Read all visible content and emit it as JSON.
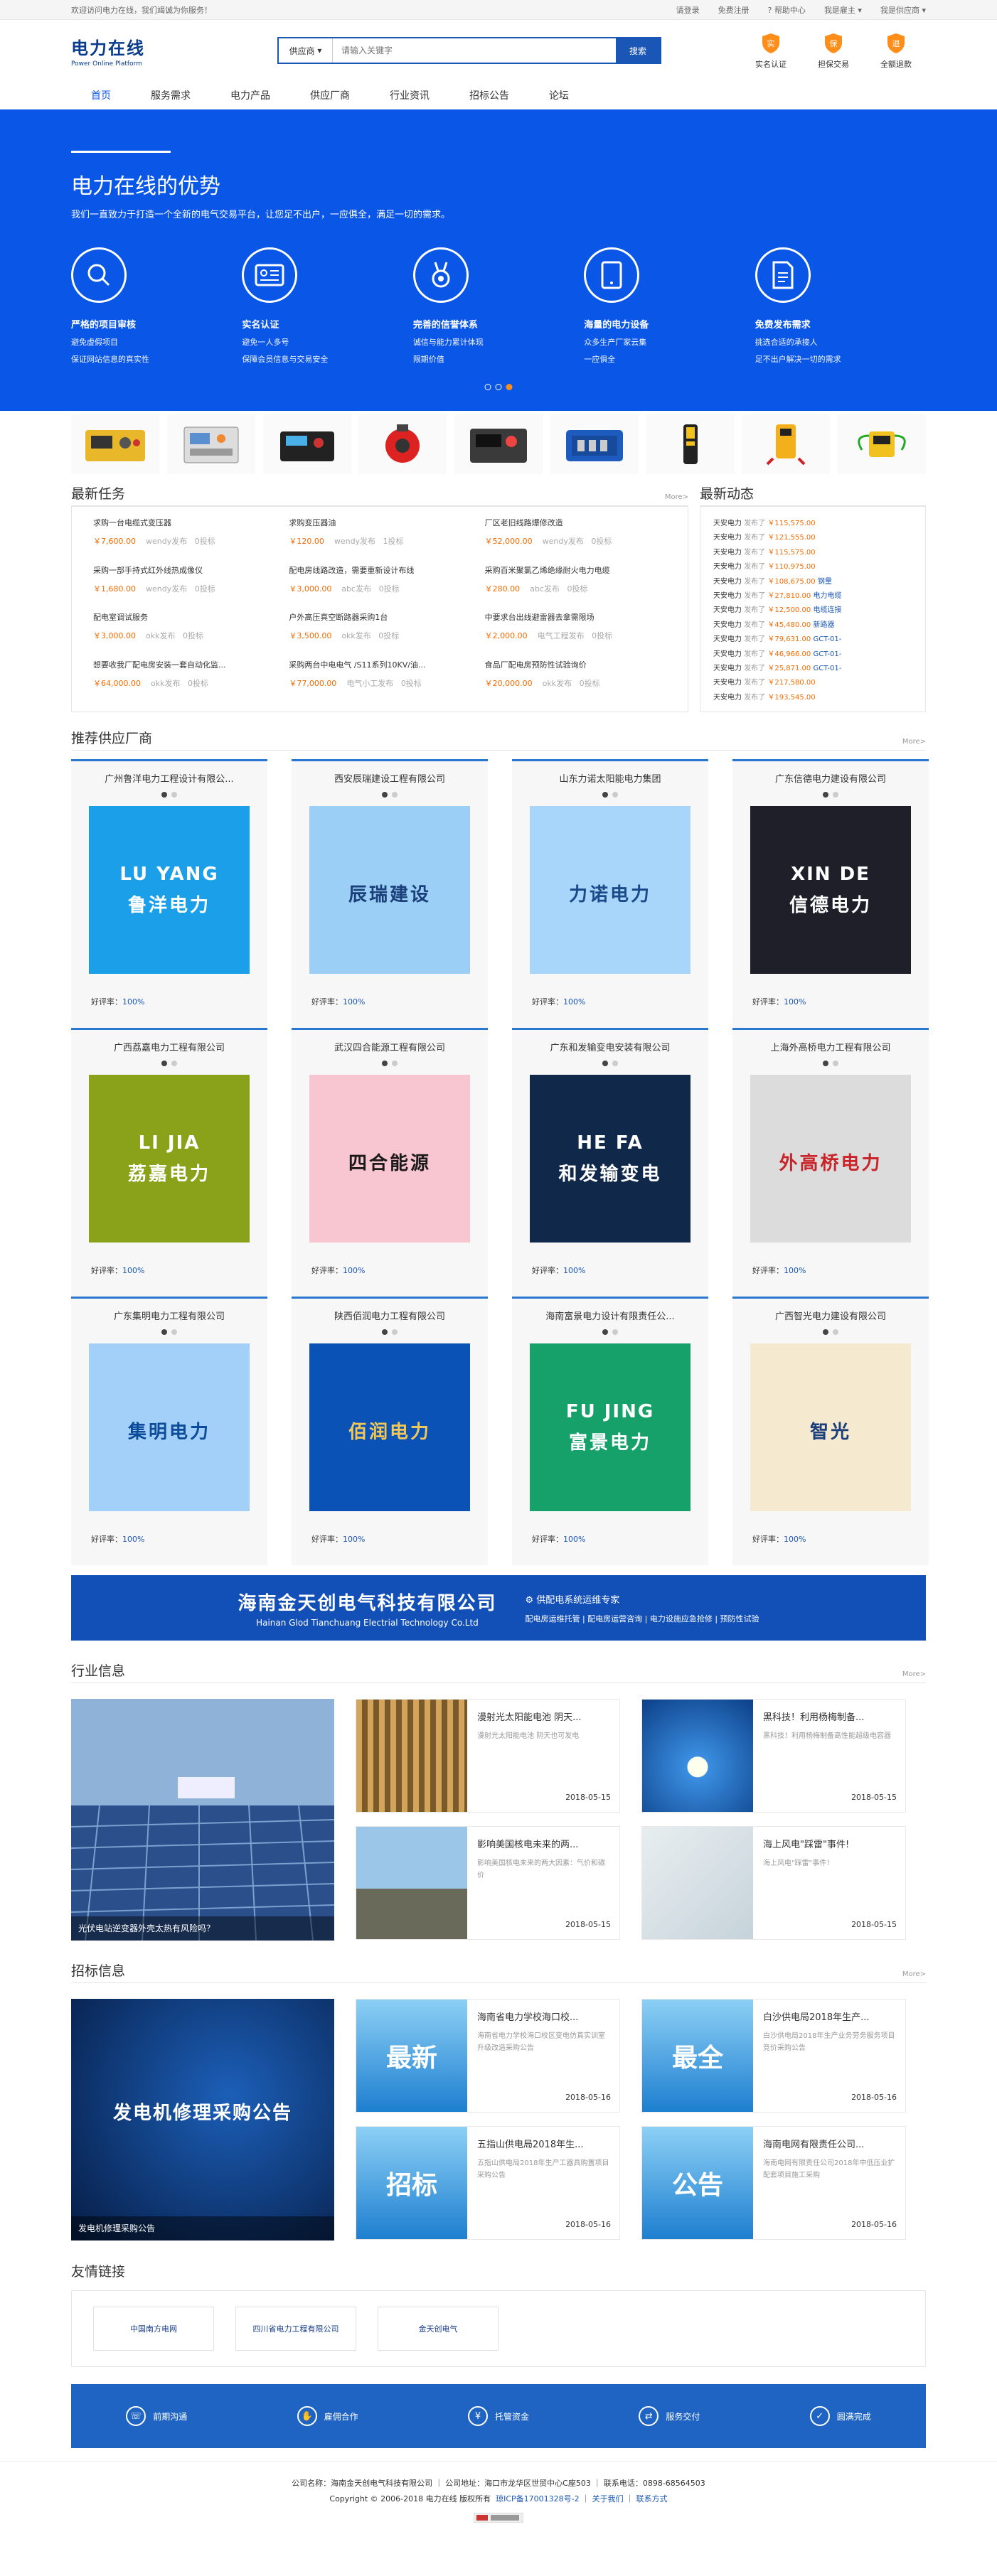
{
  "topbar": {
    "welcome": "欢迎访问电力在线，我们竭诚为你服务！",
    "links": [
      "请登录",
      "免费注册",
      "帮助中心",
      "我是雇主",
      "我是供应商"
    ]
  },
  "header": {
    "logo_title": "电力在线",
    "logo_sub": "Power Online Platform",
    "search_category": "供应商",
    "search_placeholder": "请输入关键字",
    "search_button": "搜索",
    "guarantees": [
      "实名认证",
      "担保交易",
      "全额退款"
    ]
  },
  "nav": {
    "items": [
      "首页",
      "服务需求",
      "电力产品",
      "供应厂商",
      "行业资讯",
      "招标公告",
      "论坛"
    ],
    "active": 0
  },
  "hero": {
    "title": "电力在线的优势",
    "subtitle": "我们一直致力于打造一个全新的电气交易平台，让您足不出户，一应俱全，满足一切的需求。",
    "features": [
      {
        "title": "严格的项目审核",
        "lines": [
          "避免虚假项目",
          "保证网站信息的真实性"
        ]
      },
      {
        "title": "实名认证",
        "lines": [
          "避免一人多号",
          "保障会员信息与交易安全"
        ]
      },
      {
        "title": "完善的信誉体系",
        "lines": [
          "诚信与能力累计体现",
          "限期价值"
        ]
      },
      {
        "title": "海量的电力设备",
        "lines": [
          "众多生产厂家云集",
          "一应俱全"
        ]
      },
      {
        "title": "免费发布需求",
        "lines": [
          "挑选合适的承接人",
          "足不出户解决一切的需求"
        ]
      }
    ]
  },
  "tasks": {
    "title": "最新任务",
    "more": "More>",
    "items": [
      {
        "name": "求购一台电缆式变压器",
        "price": "￥7,600.00",
        "by": "wendy发布",
        "bids": "0投标"
      },
      {
        "name": "求购变压器油",
        "price": "￥120.00",
        "by": "wendy发布",
        "bids": "1投标"
      },
      {
        "name": "厂区老旧线路爆修改造",
        "price": "￥52,000.00",
        "by": "wendy发布",
        "bids": "0投标"
      },
      {
        "name": "采购一部手持式红外线热成像仪",
        "price": "￥1,680.00",
        "by": "wendy发布",
        "bids": "0投标"
      },
      {
        "name": "配电房线路改造，需要重新设计布线",
        "price": "￥3,000.00",
        "by": "abc发布",
        "bids": "0投标"
      },
      {
        "name": "采购百米聚氯乙烯绝缘耐火电力电缆",
        "price": "￥280.00",
        "by": "abc发布",
        "bids": "0投标"
      },
      {
        "name": "配电室调试服务",
        "price": "￥3,000.00",
        "by": "okk发布",
        "bids": "0投标"
      },
      {
        "name": "户外高压真空断路器采购1台",
        "price": "￥3,500.00",
        "by": "okk发布",
        "bids": "0投标"
      },
      {
        "name": "中要求台出线避雷器去拿需限场",
        "price": "￥2,000.00",
        "by": "电气工程发布",
        "bids": "0投标"
      },
      {
        "name": "想要收我厂配电房安装一套自动化监...",
        "price": "￥64,000.00",
        "by": "okk发布",
        "bids": "0投标"
      },
      {
        "name": "采购两台中电电气 /S11系列10KV/油...",
        "price": "￥77,000.00",
        "by": "电气小工发布",
        "bids": "0投标"
      },
      {
        "name": "食品厂配电房预防性试验询价",
        "price": "￥20,000.00",
        "by": "okk发布",
        "bids": "0投标"
      }
    ]
  },
  "feed": {
    "title": "最新动态",
    "rows": [
      {
        "user": "天安电力",
        "action": "发布了",
        "price": "￥115,575.00",
        "tag": ""
      },
      {
        "user": "天安电力",
        "action": "发布了",
        "price": "￥121,555.00",
        "tag": ""
      },
      {
        "user": "天安电力",
        "action": "发布了",
        "price": "￥115,575.00",
        "tag": ""
      },
      {
        "user": "天安电力",
        "action": "发布了",
        "price": "￥110,975.00",
        "tag": ""
      },
      {
        "user": "天安电力",
        "action": "发布了",
        "price": "￥108,675.00",
        "tag": "钢量"
      },
      {
        "user": "天安电力",
        "action": "发布了",
        "price": "￥27,810.00",
        "tag": "电力电缆"
      },
      {
        "user": "天安电力",
        "action": "发布了",
        "price": "￥12,500.00",
        "tag": "电缆连接"
      },
      {
        "user": "天安电力",
        "action": "发布了",
        "price": "￥45,480.00",
        "tag": "新路器"
      },
      {
        "user": "天安电力",
        "action": "发布了",
        "price": "￥79,631.00",
        "tag": "GCT-01-"
      },
      {
        "user": "天安电力",
        "action": "发布了",
        "price": "￥46,966.00",
        "tag": "GCT-01-"
      },
      {
        "user": "天安电力",
        "action": "发布了",
        "price": "￥25,871.00",
        "tag": "GCT-01-"
      },
      {
        "user": "天安电力",
        "action": "发布了",
        "price": "￥217,580.00",
        "tag": ""
      },
      {
        "user": "天安电力",
        "action": "发布了",
        "price": "￥193,545.00",
        "tag": ""
      }
    ]
  },
  "suppliers": {
    "title": "推荐供应厂商",
    "more": "More>",
    "rating_label": "好评率：",
    "items": [
      {
        "name": "广州鲁洋电力工程设计有限公...",
        "bg": "#1a9fe8",
        "fg": "#ffffff",
        "l1": "LU YANG",
        "l2": "鲁洋电力",
        "rating": "100%"
      },
      {
        "name": "西安辰瑞建设工程有限公司",
        "bg": "#9ccff6",
        "fg": "#1a3f7a",
        "l1": "",
        "l2": "辰瑞建设",
        "rating": "100%"
      },
      {
        "name": "山东力诺太阳能电力集团",
        "bg": "#a8d6fa",
        "fg": "#1a4a8a",
        "l1": "",
        "l2": "力诺电力",
        "rating": "100%"
      },
      {
        "name": "广东信德电力建设有限公司",
        "bg": "#1f1f2a",
        "fg": "#ffffff",
        "l1": "XIN DE",
        "l2": "信德电力",
        "rating": "100%"
      },
      {
        "name": "广西荔嘉电力工程有限公司",
        "bg": "#8aa11a",
        "fg": "#ffffff",
        "l1": "LI JIA",
        "l2": "荔嘉电力",
        "rating": "100%"
      },
      {
        "name": "武汉四合能源工程有限公司",
        "bg": "#f8c6d0",
        "fg": "#1a1a1a",
        "l1": "",
        "l2": "四合能源",
        "rating": "100%"
      },
      {
        "name": "广东和发输变电安装有限公司",
        "bg": "#10284a",
        "fg": "#ffffff",
        "l1": "HE FA",
        "l2": "和发输变电",
        "rating": "100%"
      },
      {
        "name": "上海外高桥电力工程有限公司",
        "bg": "#dcdcdc",
        "fg": "#c8242a",
        "l1": "",
        "l2": "外高桥电力",
        "rating": "100%"
      },
      {
        "name": "广东集明电力工程有限公司",
        "bg": "#a3d0f8",
        "fg": "#0c4a9a",
        "l1": "",
        "l2": "集明电力",
        "rating": "100%"
      },
      {
        "name": "陕西佰润电力工程有限公司",
        "bg": "#0b52b6",
        "fg": "#f0c85a",
        "l1": "",
        "l2": "佰润电力",
        "rating": "100%"
      },
      {
        "name": "海南富景电力设计有限责任公...",
        "bg": "#16a06a",
        "fg": "#ffffff",
        "l1": "FU JING",
        "l2": "富景电力",
        "rating": "100%"
      },
      {
        "name": "广西智光电力建设有限公司",
        "bg": "#f5ead0",
        "fg": "#1a3f7a",
        "l1": "",
        "l2": "智光",
        "rating": "100%"
      }
    ]
  },
  "ad": {
    "title": "海南金天创电气科技有限公司",
    "sub": "Hainan Glod Tianchuang Electrial Technology Co.Ltd",
    "right_title": "供配电系统运维专家",
    "right_sub": "配电房运维托管 | 配电房运营咨询 | 电力设施应急抢修 | 预防性试验"
  },
  "industry": {
    "title": "行业信息",
    "more": "More>",
    "big_caption": "光伏电站逆变器外壳太热有风险吗？",
    "items": [
      {
        "title": "漫射光太阳能电池 阴天...",
        "desc": "漫射光太阳能电池 阴天也可发电",
        "date": "2018-05-15",
        "bg": "#8b6a3a"
      },
      {
        "title": "黑科技！利用杨梅制备...",
        "desc": "黑科技！利用杨梅制备高性能超级电容器",
        "date": "2018-05-15",
        "bg": "#1b74c8"
      },
      {
        "title": "影响美国核电未来的两...",
        "desc": "影响美国核电未来的两大因素：气价和碳价",
        "date": "2018-05-15",
        "bg": "#b8d4e8"
      },
      {
        "title": "海上风电\"踩雷\"事件!",
        "desc": "海上风电\"踩雷\"事件！",
        "date": "2018-05-15",
        "bg": "#dde8ec"
      }
    ]
  },
  "tender": {
    "title": "招标信息",
    "more": "More>",
    "big_caption": "发电机修理采购公告",
    "big_text": "发电机修理采购公告",
    "items": [
      {
        "badge": "最新",
        "title": "海南省电力学校海口校...",
        "desc": "海南省电力学校海口校区变电仿真实训室升级改造采购公告",
        "date": "2018-05-16"
      },
      {
        "badge": "最全",
        "title": "白沙供电局2018年生产...",
        "desc": "白沙供电局2018年生产业务劳务服务项目竞价采购公告",
        "date": "2018-05-16"
      },
      {
        "badge": "招标",
        "title": "五指山供电局2018年生...",
        "desc": "五指山供电局2018年生产工器具购置项目采购公告",
        "date": "2018-05-16"
      },
      {
        "badge": "公告",
        "title": "海南电网有限责任公司...",
        "desc": "海南电网有限责任公司2018年中低压业扩配套项目施工采购",
        "date": "2018-05-16"
      }
    ]
  },
  "friends": {
    "title": "友情链接",
    "links": [
      "中国南方电网",
      "四川省电力工程有限公司",
      "金天创电气"
    ]
  },
  "services": [
    "前期沟通",
    "雇佣合作",
    "托管资金",
    "服务交付",
    "圆满完成"
  ],
  "footer": {
    "line1": "公司名称：海南金天创电气科技有限公司 ｜ 公司地址：海口市龙华区世贸中心C座503 ｜ 联系电话：0898-68564503",
    "copy": "Copyright © 2006-2018 电力在线 版权所有",
    "icp": "琼ICP备17001328号-2",
    "about": "关于我们",
    "contact": "联系方式"
  },
  "colors": {
    "primary": "#0a56e6",
    "accent": "#f56a00",
    "link": "#1a56b5"
  }
}
